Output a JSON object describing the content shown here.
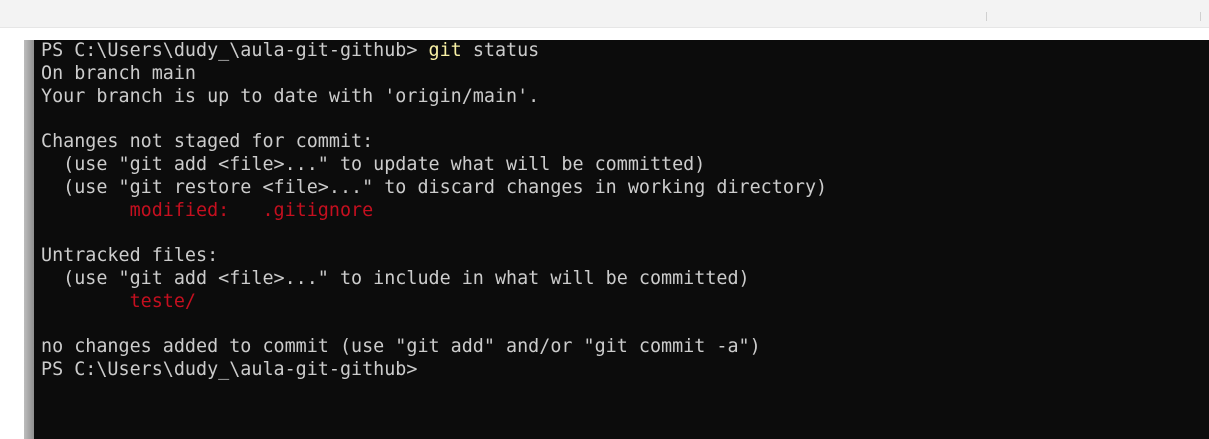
{
  "terminal": {
    "lines": [
      {
        "parts": [
          {
            "t": "PS C:\\Users\\dudy_\\aula-git-github> ",
            "c": "normal"
          },
          {
            "t": "git",
            "c": "cmd"
          },
          {
            "t": " status",
            "c": "normal"
          }
        ]
      },
      {
        "parts": [
          {
            "t": "On branch main",
            "c": "normal"
          }
        ]
      },
      {
        "parts": [
          {
            "t": "Your branch is up to date with 'origin/main'.",
            "c": "normal"
          }
        ]
      },
      {
        "parts": []
      },
      {
        "parts": [
          {
            "t": "Changes not staged for commit:",
            "c": "normal"
          }
        ]
      },
      {
        "parts": [
          {
            "t": "  (use \"git add <file>...\" to update what will be committed)",
            "c": "normal"
          }
        ]
      },
      {
        "parts": [
          {
            "t": "  (use \"git restore <file>...\" to discard changes in working directory)",
            "c": "normal"
          }
        ]
      },
      {
        "parts": [
          {
            "t": "        modified:   .gitignore",
            "c": "red"
          }
        ]
      },
      {
        "parts": []
      },
      {
        "parts": [
          {
            "t": "Untracked files:",
            "c": "normal"
          }
        ]
      },
      {
        "parts": [
          {
            "t": "  (use \"git add <file>...\" to include in what will be committed)",
            "c": "normal"
          }
        ]
      },
      {
        "parts": [
          {
            "t": "        teste/",
            "c": "red"
          }
        ]
      },
      {
        "parts": []
      },
      {
        "parts": [
          {
            "t": "no changes added to commit (use \"git add\" and/or \"git commit -a\")",
            "c": "normal"
          }
        ]
      },
      {
        "parts": [
          {
            "t": "PS C:\\Users\\dudy_\\aula-git-github> ",
            "c": "normal"
          }
        ]
      }
    ]
  },
  "colors": {
    "background": "#0c0c0c",
    "text": "#cccccc",
    "command": "#f9f1a5",
    "error": "#c50f1f"
  }
}
